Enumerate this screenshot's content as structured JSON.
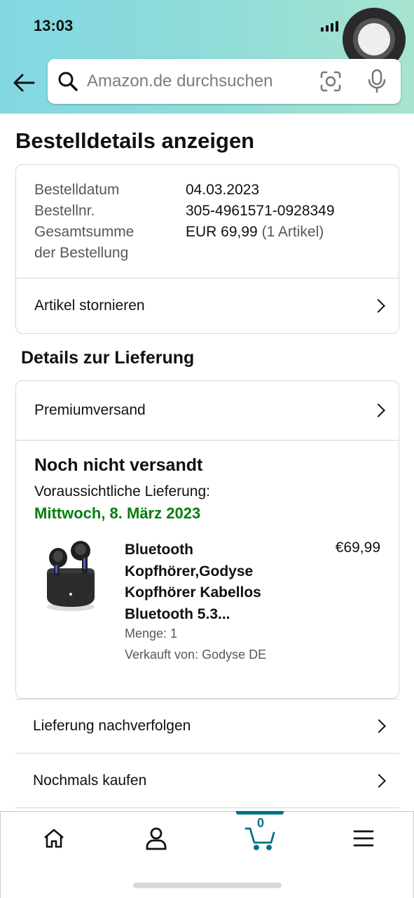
{
  "status_bar": {
    "time": "13:03"
  },
  "search": {
    "placeholder": "Amazon.de durchsuchen"
  },
  "page": {
    "title": "Bestelldetails anzeigen"
  },
  "order_summary": {
    "date_label": "Bestelldatum",
    "date_value": "04.03.2023",
    "number_label": "Bestellnr.",
    "number_value": "305-4961571-0928349",
    "total_label_line1": "Gesamtsumme",
    "total_label_line2": "der Bestellung",
    "total_value": "EUR 69,99",
    "total_items": "(1 Artikel)",
    "cancel_label": "Artikel stornieren"
  },
  "delivery": {
    "section_title": "Details zur Lieferung",
    "shipping_method": "Premiumversand",
    "status": "Noch nicht versandt",
    "eta_label": "Voraussichtliche Lieferung:",
    "eta_date": "Mittwoch, 8. März 2023",
    "eta_color": "#067d0e"
  },
  "item": {
    "title": "Bluetooth Kopfhörer,Godyse Kopfhörer Kabellos Bluetooth 5.3...",
    "price": "€69,99",
    "quantity": "Menge: 1",
    "seller": "Verkauft von: Godyse DE",
    "image_icon": "earbuds-product-image"
  },
  "actions": {
    "track_label": "Lieferung nachverfolgen",
    "buy_again_label": "Nochmals kaufen"
  },
  "tabbar": {
    "cart_count": "0",
    "accent_color": "#007185",
    "icons": [
      "home-icon",
      "account-icon",
      "cart-icon",
      "menu-icon"
    ]
  }
}
